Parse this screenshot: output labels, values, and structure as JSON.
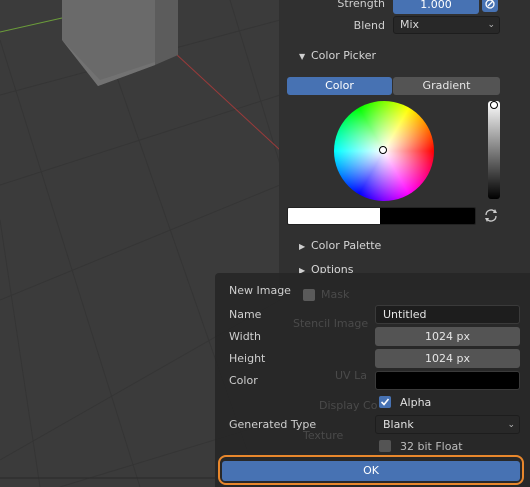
{
  "colors": {
    "accent": "#4772b3",
    "highlight_ring": "#e8872c"
  },
  "brush_panel": {
    "strength_label": "Strength",
    "strength_value": "1.000",
    "blend_label": "Blend",
    "blend_value": "Mix",
    "color_picker_title": "Color Picker",
    "tab_color": "Color",
    "tab_gradient": "Gradient",
    "color_palette_title": "Color Palette",
    "options_title": "Options"
  },
  "background_ghost": {
    "mask": "Mask",
    "stencil_image": "Stencil Image",
    "uv_layer": "UV La",
    "display_color": "Display Co",
    "texture": "Texture"
  },
  "new_image_dialog": {
    "title": "New Image",
    "name_label": "Name",
    "name_value": "Untitled",
    "width_label": "Width",
    "width_value": "1024 px",
    "height_label": "Height",
    "height_value": "1024 px",
    "color_label": "Color",
    "alpha_label": "Alpha",
    "alpha_checked": true,
    "generated_type_label": "Generated Type",
    "generated_type_value": "Blank",
    "float_label": "32 bit Float",
    "float_checked": false,
    "ok_label": "OK"
  }
}
